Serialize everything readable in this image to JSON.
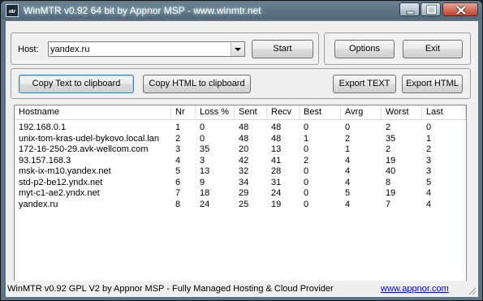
{
  "window": {
    "title": "WinMTR v0.92 64 bit by Appnor MSP - www.winmtr.net",
    "icon_text": "mtr",
    "icons": {
      "app": "winmtr-app-icon",
      "min": "minimize-icon",
      "max": "maximize-icon",
      "close": "close-icon"
    }
  },
  "host": {
    "label": "Host:",
    "value": "yandex.ru"
  },
  "buttons": {
    "start": "Start",
    "options": "Options",
    "exit": "Exit",
    "copy_text": "Copy Text to clipboard",
    "copy_html": "Copy HTML to clipboard",
    "export_text": "Export TEXT",
    "export_html": "Export HTML"
  },
  "table": {
    "columns": [
      "Hostname",
      "Nr",
      "Loss %",
      "Sent",
      "Recv",
      "Best",
      "Avrg",
      "Worst",
      "Last"
    ],
    "rows": [
      [
        "192.168.0.1",
        "1",
        "0",
        "48",
        "48",
        "0",
        "0",
        "2",
        "0"
      ],
      [
        "unix-tom-kras-udel-bykovo.local.lan",
        "2",
        "0",
        "48",
        "48",
        "1",
        "2",
        "35",
        "1"
      ],
      [
        "172-16-250-29.avk-wellcom.com",
        "3",
        "35",
        "20",
        "13",
        "0",
        "1",
        "2",
        "2"
      ],
      [
        "93.157.168.3",
        "4",
        "3",
        "42",
        "41",
        "2",
        "4",
        "19",
        "3"
      ],
      [
        "msk-ix-m10.yandex.net",
        "5",
        "13",
        "32",
        "28",
        "0",
        "4",
        "40",
        "3"
      ],
      [
        "std-p2-be12.yndx.net",
        "6",
        "9",
        "34",
        "31",
        "0",
        "4",
        "8",
        "5"
      ],
      [
        "myt-c1-ae2.yndx.net",
        "7",
        "18",
        "29",
        "24",
        "0",
        "5",
        "19",
        "4"
      ],
      [
        "yandex.ru",
        "8",
        "24",
        "25",
        "19",
        "0",
        "4",
        "7",
        "4"
      ]
    ]
  },
  "status": {
    "text": "WinMTR v0.92 GPL V2 by Appnor MSP - Fully Managed Hosting & Cloud Provider",
    "link": "www.appnor.com"
  },
  "colors": {
    "titlebar": "#5e7383",
    "client": "#f0f0f0",
    "link": "#0000ee",
    "close_button": "#c2412b"
  }
}
